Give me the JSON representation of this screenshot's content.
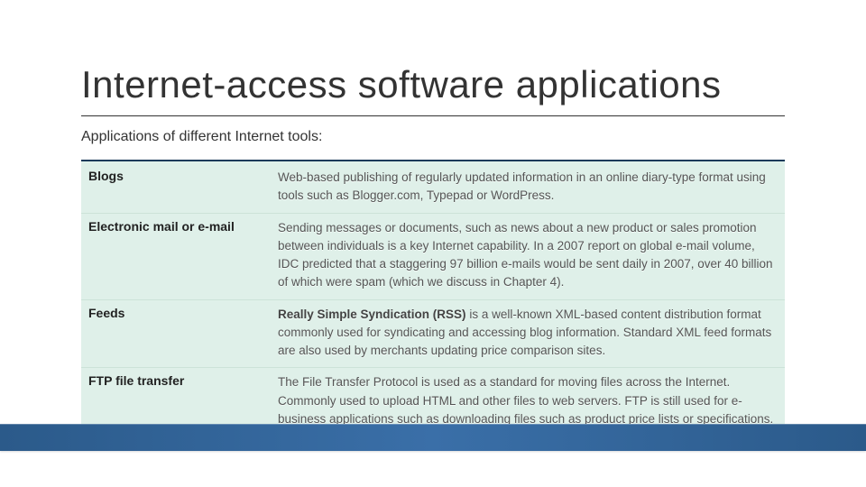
{
  "title": "Internet-access software applications",
  "subtitle": "Applications of different Internet tools:",
  "rows": [
    {
      "term": "Blogs",
      "desc": "Web-based publishing of regularly updated information in an online diary-type format using tools such as Blogger.com, Typepad or WordPress."
    },
    {
      "term": "Electronic mail or e-mail",
      "desc": "Sending messages or documents, such as news about a new product or sales promotion between individuals is a key Internet capability. In a 2007 report on global e-mail volume, IDC predicted that a staggering 97 billion e-mails would be sent daily in 2007, over 40 billion of which were spam (which we discuss in Chapter 4)."
    },
    {
      "term": "Feeds",
      "lead_bold": "Really Simple Syndication (RSS)",
      "desc_rest": " is a well-known XML-based content distribution format commonly used for syndicating and accessing blog information. Standard XML feed formats are also used by merchants updating price comparison sites."
    },
    {
      "term": "FTP file transfer",
      "desc": "The File Transfer Protocol is used as a standard for moving files across the Internet. Commonly used to upload HTML and other files to web servers. FTP is still used for e-business applications such as downloading files such as product price lists or specifications."
    }
  ]
}
